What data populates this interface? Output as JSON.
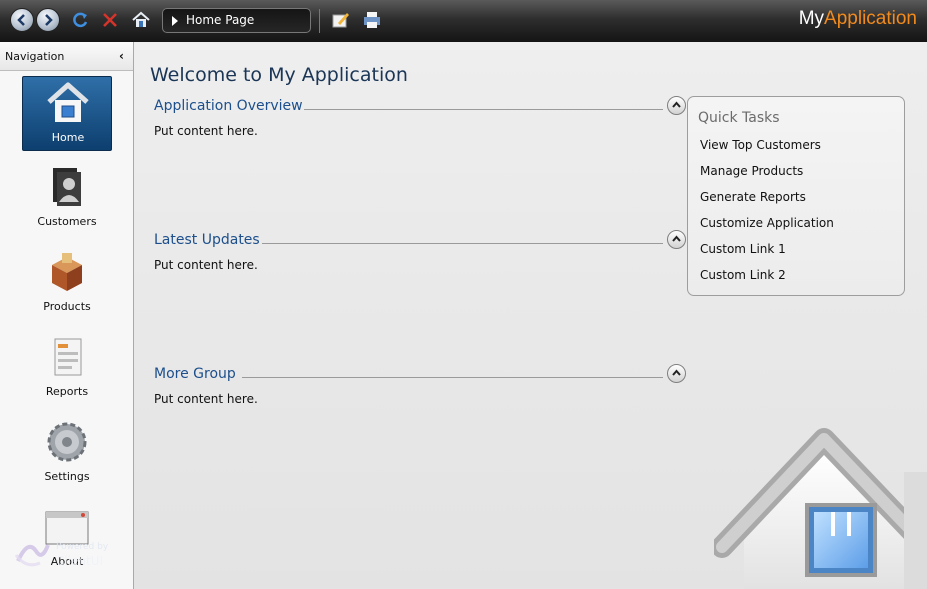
{
  "toolbar": {
    "address": "Home Page",
    "brand_first": "My",
    "brand_second": "Application"
  },
  "sidebar": {
    "title": "Navigation",
    "items": [
      {
        "label": "Home",
        "active": true
      },
      {
        "label": "Customers"
      },
      {
        "label": "Products"
      },
      {
        "label": "Reports"
      },
      {
        "label": "Settings"
      },
      {
        "label": "About"
      }
    ],
    "powered_by": "Powered by",
    "powered_brand": "ClientUI"
  },
  "main": {
    "title": "Welcome to My Application",
    "groups": [
      {
        "title": "Application Overview",
        "body": "Put content here."
      },
      {
        "title": "Latest Updates",
        "body": "Put content here."
      },
      {
        "title": "More Group",
        "body": "Put content here."
      }
    ]
  },
  "quick_tasks": {
    "title": "Quick Tasks",
    "links": [
      "View Top Customers",
      "Manage Products",
      "Generate Reports",
      "Customize Application",
      "Custom Link 1",
      "Custom Link 2"
    ]
  },
  "colors": {
    "brand_accent": "#f28a1c",
    "active_nav": "#1f5a90",
    "group_title": "#1c4f8c"
  }
}
